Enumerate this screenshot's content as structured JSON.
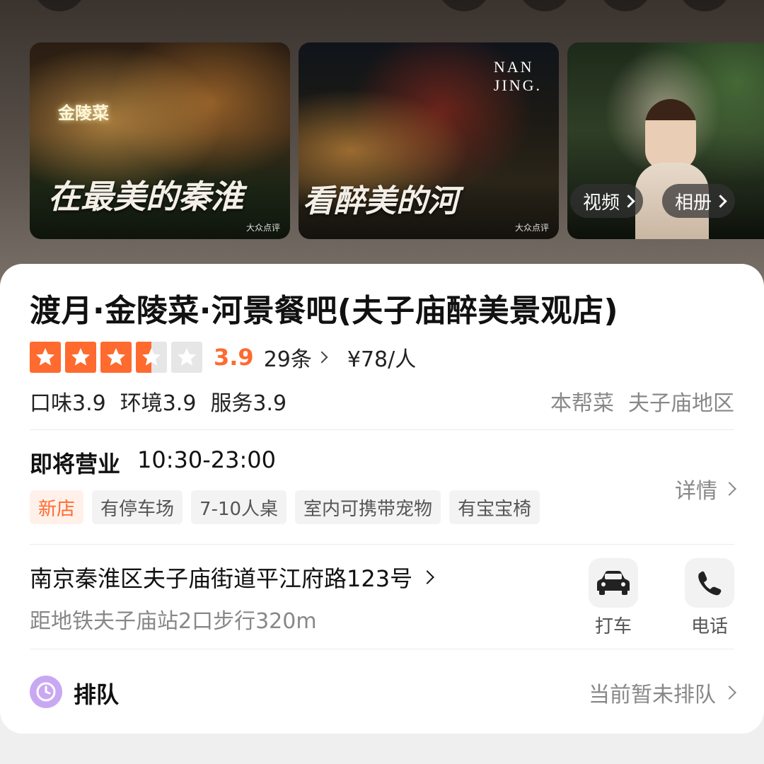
{
  "gallery": {
    "photo1": {
      "caption": "在最美的秦淮",
      "sign": "金陵菜",
      "watermark": "大众点评"
    },
    "photo2": {
      "caption": "看醉美的河",
      "logo_line1": "NAN",
      "logo_line2": "JING.",
      "watermark": "大众点评"
    },
    "photo3": {
      "video_label": "视频",
      "album_label": "相册"
    }
  },
  "shop": {
    "title": "渡月·金陵菜·河景餐吧(夫子庙醉美景观店)",
    "rating": 3.9,
    "rating_text": "3.9",
    "stars": [
      "full",
      "full",
      "full",
      "half",
      "empty"
    ],
    "reviews": "29条",
    "price": "¥78/人",
    "subscores": {
      "taste": "口味3.9",
      "environment": "环境3.9",
      "service": "服务3.9"
    },
    "cuisine": "本帮菜",
    "area": "夫子庙地区"
  },
  "hours": {
    "status": "即将营业",
    "time": "10:30-23:00",
    "details_label": "详情"
  },
  "chips": [
    "新店",
    "有停车场",
    "7-10人桌",
    "室内可携带宠物",
    "有宝宝椅"
  ],
  "address": {
    "text": "南京秦淮区夫子庙街道平江府路123号",
    "metro": "距地铁夫子庙站2口步行320m"
  },
  "actions": {
    "taxi": "打车",
    "phone": "电话"
  },
  "queue": {
    "label": "排队",
    "status": "当前暂未排队"
  },
  "colors": {
    "accent": "#ff6a2f",
    "queue_icon": "#c9a8f3"
  }
}
